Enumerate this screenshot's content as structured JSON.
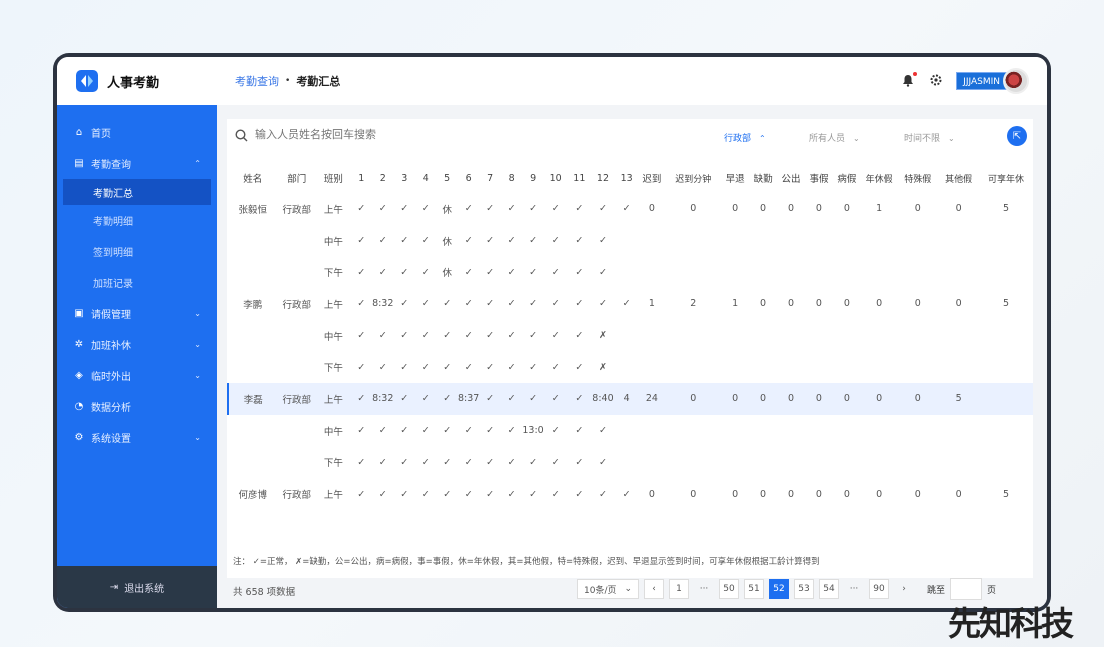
{
  "app": {
    "title": "人事考勤"
  },
  "breadcrumb": {
    "parent": "考勤查询",
    "current": "考勤汇总"
  },
  "user": {
    "name": "JJJASMIN"
  },
  "sidebar": {
    "items": [
      {
        "label": "首页",
        "icon": "home-icon"
      },
      {
        "label": "考勤查询",
        "icon": "attendance-icon",
        "chev": "⌃"
      },
      {
        "label": "考勤汇总"
      },
      {
        "label": "考勤明细"
      },
      {
        "label": "签到明细"
      },
      {
        "label": "加班记录"
      },
      {
        "label": "请假管理",
        "icon": "leave-icon",
        "chev": "⌄"
      },
      {
        "label": "加班补休",
        "icon": "overtime-icon",
        "chev": "⌄"
      },
      {
        "label": "临时外出",
        "icon": "outing-icon",
        "chev": "⌄"
      },
      {
        "label": "数据分析",
        "icon": "analytics-icon"
      },
      {
        "label": "系统设置",
        "icon": "settings-icon",
        "chev": "⌄"
      }
    ],
    "logout": "退出系统"
  },
  "search": {
    "placeholder": "输入人员姓名按回车搜索"
  },
  "filters": {
    "dept": "行政部",
    "people": "所有人员",
    "time": "时间不限"
  },
  "table": {
    "headers": [
      "姓名",
      "部门",
      "班别",
      "1",
      "2",
      "3",
      "4",
      "5",
      "6",
      "7",
      "8",
      "9",
      "10",
      "11",
      "12",
      "13",
      "迟到",
      "迟到分钟",
      "早退",
      "缺勤",
      "公出",
      "事假",
      "病假",
      "年休假",
      "特殊假",
      "其他假",
      "可享年休"
    ],
    "rows": [
      [
        "张毅恒",
        "行政部",
        "上午",
        "✓",
        "✓",
        "✓",
        "✓",
        "休",
        "✓",
        "✓",
        "✓",
        "✓",
        "✓",
        "✓",
        "✓",
        "✓",
        "0",
        "0",
        "0",
        "0",
        "0",
        "0",
        "0",
        "1",
        "0",
        "0",
        "5"
      ],
      [
        "",
        "",
        "中午",
        "✓",
        "✓",
        "✓",
        "✓",
        "休",
        "✓",
        "✓",
        "✓",
        "✓",
        "✓",
        "✓",
        "✓",
        "",
        "",
        "",
        "",
        "",
        "",
        "",
        "",
        "",
        "",
        "",
        ""
      ],
      [
        "",
        "",
        "下午",
        "✓",
        "✓",
        "✓",
        "✓",
        "休",
        "✓",
        "✓",
        "✓",
        "✓",
        "✓",
        "✓",
        "✓",
        "",
        "",
        "",
        "",
        "",
        "",
        "",
        "",
        "",
        "",
        "",
        ""
      ],
      [
        "李鹏",
        "行政部",
        "上午",
        "✓",
        "8:32",
        "✓",
        "✓",
        "✓",
        "✓",
        "✓",
        "✓",
        "✓",
        "✓",
        "✓",
        "✓",
        "✓",
        "1",
        "2",
        "1",
        "0",
        "0",
        "0",
        "0",
        "0",
        "0",
        "0",
        "5"
      ],
      [
        "",
        "",
        "中午",
        "✓",
        "✓",
        "✓",
        "✓",
        "✓",
        "✓",
        "✓",
        "✓",
        "✓",
        "✓",
        "✓",
        "✗",
        "",
        "",
        "",
        "",
        "",
        "",
        "",
        "",
        "",
        "",
        "",
        ""
      ],
      [
        "",
        "",
        "下午",
        "✓",
        "✓",
        "✓",
        "✓",
        "✓",
        "✓",
        "✓",
        "✓",
        "✓",
        "✓",
        "✓",
        "✗",
        "",
        "",
        "",
        "",
        "",
        "",
        "",
        "",
        "",
        "",
        "",
        ""
      ],
      [
        "李磊",
        "行政部",
        "上午",
        "✓",
        "8:32",
        "✓",
        "✓",
        "✓",
        "8:37",
        "✓",
        "✓",
        "✓",
        "✓",
        "✓",
        "8:40",
        "4",
        "24",
        "0",
        "0",
        "0",
        "0",
        "0",
        "0",
        "0",
        "0",
        "5",
        ""
      ],
      [
        "",
        "",
        "中午",
        "✓",
        "✓",
        "✓",
        "✓",
        "✓",
        "✓",
        "✓",
        "✓",
        "13:05",
        "✓",
        "✓",
        "✓",
        "",
        "",
        "",
        "",
        "",
        "",
        "",
        "",
        "",
        "",
        "",
        ""
      ],
      [
        "",
        "",
        "下午",
        "✓",
        "✓",
        "✓",
        "✓",
        "✓",
        "✓",
        "✓",
        "✓",
        "✓",
        "✓",
        "✓",
        "✓",
        "",
        "",
        "",
        "",
        "",
        "",
        "",
        "",
        "",
        "",
        "",
        ""
      ],
      [
        "何彦博",
        "行政部",
        "上午",
        "✓",
        "✓",
        "✓",
        "✓",
        "✓",
        "✓",
        "✓",
        "✓",
        "✓",
        "✓",
        "✓",
        "✓",
        "✓",
        "0",
        "0",
        "0",
        "0",
        "0",
        "0",
        "0",
        "0",
        "0",
        "0",
        "5"
      ]
    ]
  },
  "note": "注：  ✓=正常，  ✗=缺勤，公=公出，病=病假，事=事假，休=年休假，其=其他假，特=特殊假，迟到、早退显示签到时间，可享年休假根据工龄计算得到",
  "pagination": {
    "total": "共 658 项数据",
    "page_size": "10条/页",
    "pages": [
      "1",
      "···",
      "50",
      "51",
      "52",
      "53",
      "54",
      "···",
      "90"
    ],
    "active": "52",
    "goto_label": "跳至",
    "page_unit": "页"
  },
  "watermark": "先知科技"
}
